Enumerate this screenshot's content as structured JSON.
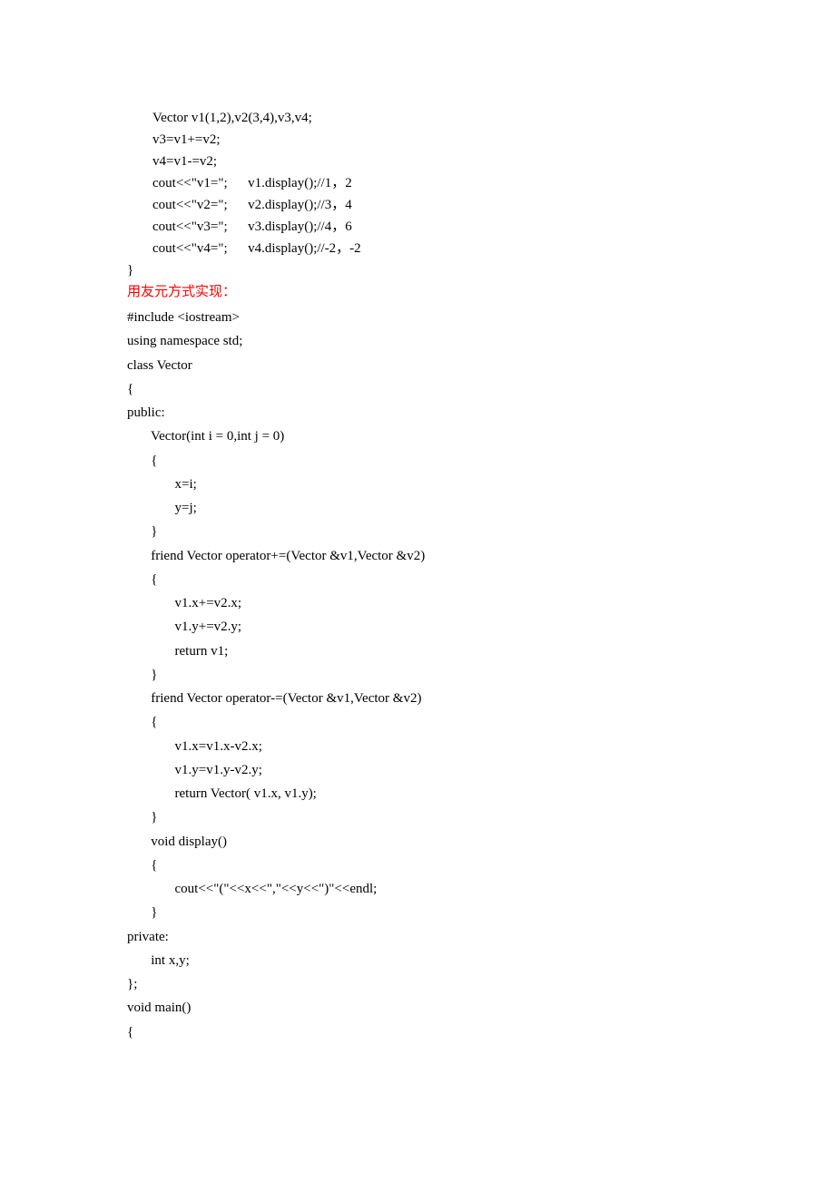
{
  "block1": {
    "l1": "Vector v1(1,2),v2(3,4),v3,v4;",
    "l2": "v3=v1+=v2;",
    "l3": "v4=v1-=v2;",
    "l4": "cout<<\"v1=\";      v1.display();//1，2",
    "l5": "cout<<\"v2=\";      v2.display();//3，4",
    "l6": "cout<<\"v3=\";      v3.display();//4，6",
    "l7": "cout<<\"v4=\";      v4.display();//-2，-2",
    "l8": "}"
  },
  "heading": "用友元方式实现：",
  "code": {
    "l1": "#include <iostream>",
    "l2": "using namespace std;",
    "l3": "class Vector",
    "l4": "{",
    "l5": "public:",
    "l6": "       Vector(int i = 0,int j = 0)",
    "l7": "       {",
    "l8": "              x=i;",
    "l9": "              y=j;",
    "l10": "       }",
    "l11": "       friend Vector operator+=(Vector &v1,Vector &v2)",
    "l12": "       {",
    "l13": "              v1.x+=v2.x;",
    "l14": "              v1.y+=v2.y;",
    "l15": "              return v1;",
    "l16": "       }",
    "l17": "       friend Vector operator-=(Vector &v1,Vector &v2)",
    "l18": "       {",
    "l19": "              v1.x=v1.x-v2.x;",
    "l20": "              v1.y=v1.y-v2.y;",
    "l21": "              return Vector( v1.x, v1.y);",
    "l22": "       }",
    "l23": "       void display()",
    "l24": "       {",
    "l25": "              cout<<\"(\"<<x<<\",\"<<y<<\")\"<<endl;",
    "l26": "       }",
    "l27": "private:",
    "l28": "       int x,y;",
    "l29": "};",
    "l30": "void main()",
    "l31": "{"
  }
}
